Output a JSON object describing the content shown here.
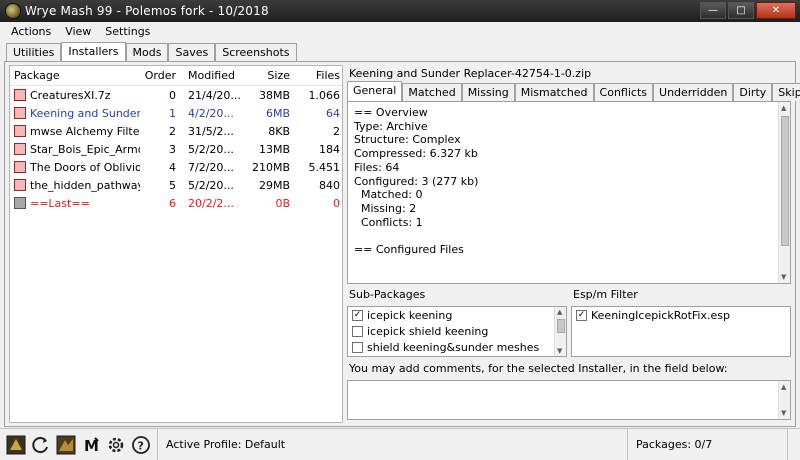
{
  "window": {
    "title": "Wrye Mash 99 - Polemos fork - 10/2018"
  },
  "menu": [
    "Actions",
    "View",
    "Settings"
  ],
  "main_tabs": [
    "Utilities",
    "Installers",
    "Mods",
    "Saves",
    "Screenshots"
  ],
  "main_tab_active": "Installers",
  "list": {
    "columns": [
      "Package",
      "Order",
      "Modified",
      "Size",
      "Files"
    ],
    "rows": [
      {
        "package": "CreaturesXI.7z",
        "order": "0",
        "modified": "21/4/20...",
        "size": "38MB",
        "files": "1.066",
        "style": "normal"
      },
      {
        "package": "Keening and Sunder ...",
        "order": "1",
        "modified": "4/2/20...",
        "size": "6MB",
        "files": "64",
        "style": "blue"
      },
      {
        "package": "mwse Alchemy Filte...",
        "order": "2",
        "modified": "31/5/2...",
        "size": "8KB",
        "files": "2",
        "style": "normal"
      },
      {
        "package": "Star_Bois_Epic_Armo...",
        "order": "3",
        "modified": "5/2/20...",
        "size": "13MB",
        "files": "184",
        "style": "normal"
      },
      {
        "package": "The Doors of Oblivio...",
        "order": "4",
        "modified": "7/2/20...",
        "size": "210MB",
        "files": "5.451",
        "style": "normal"
      },
      {
        "package": "the_hidden_pathway...",
        "order": "5",
        "modified": "5/2/20...",
        "size": "29MB",
        "files": "840",
        "style": "normal"
      },
      {
        "package": "==Last==",
        "order": "6",
        "modified": "20/2/2...",
        "size": "0B",
        "files": "0",
        "style": "red"
      }
    ]
  },
  "details": {
    "package_title": "Keening and Sunder Replacer-42754-1-0.zip",
    "tabs": [
      "General",
      "Matched",
      "Missing",
      "Mismatched",
      "Conflicts",
      "Underridden",
      "Dirty",
      "Skipped"
    ],
    "active_tab": "General",
    "general_lines": [
      "== Overview",
      "Type: Archive",
      "Structure: Complex",
      "Compressed: 6.327 kb",
      "Files: 64",
      "Configured: 3 (277 kb)",
      "  Matched: 0",
      "  Missing: 2",
      "  Conflicts: 1",
      "",
      "== Configured Files"
    ]
  },
  "subpackages": {
    "label": "Sub-Packages",
    "items": [
      {
        "label": "icepick keening",
        "checked": true
      },
      {
        "label": "icepick shield keening",
        "checked": false
      },
      {
        "label": "shield keening&sunder meshes",
        "checked": false
      }
    ]
  },
  "esp_filter": {
    "label": "Esp/m Filter",
    "items": [
      {
        "label": "KeeningIcepickRotFix.esp",
        "checked": true
      }
    ]
  },
  "comments": {
    "label": "You may add comments, for the selected Installer, in the field below:",
    "value": ""
  },
  "status": {
    "profile": "Active Profile: Default",
    "packages": "Packages: 0/7"
  },
  "statusbar_icons": [
    "morrowind-launcher-icon",
    "refresh-icon",
    "mge-icon",
    "mash-m-icon",
    "settings-gear-icon",
    "help-icon"
  ]
}
